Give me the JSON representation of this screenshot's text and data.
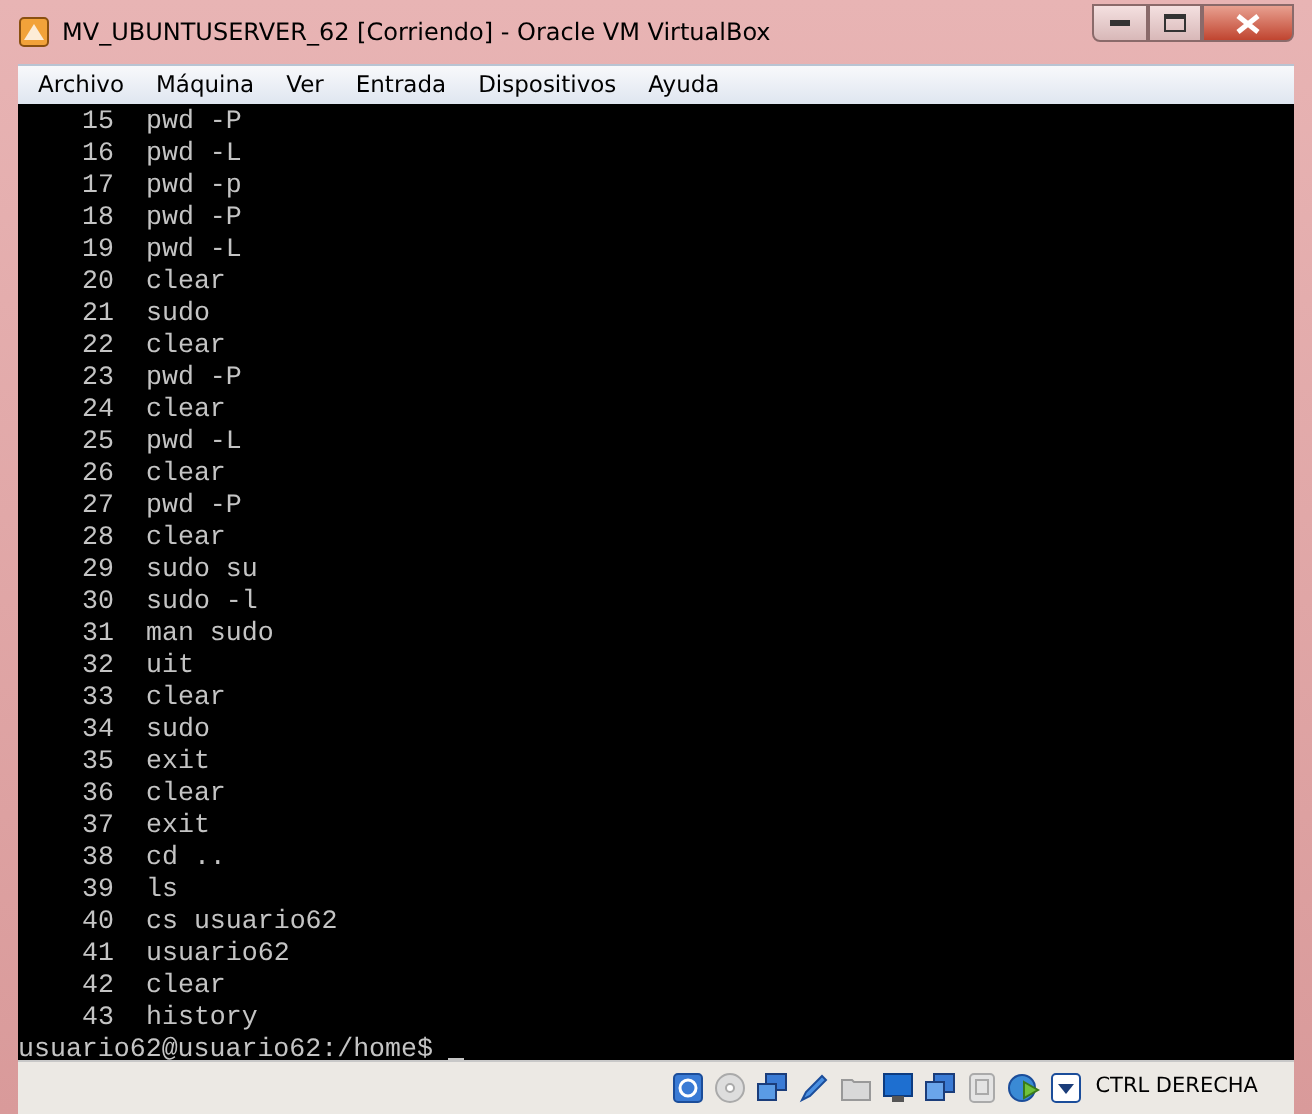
{
  "window": {
    "title": "MV_UBUNTUSERVER_62 [Corriendo] - Oracle VM VirtualBox"
  },
  "menu": [
    "Archivo",
    "Máquina",
    "Ver",
    "Entrada",
    "Dispositivos",
    "Ayuda"
  ],
  "terminal": {
    "history": [
      {
        "number": "15",
        "command": "pwd -P"
      },
      {
        "number": "16",
        "command": "pwd -L"
      },
      {
        "number": "17",
        "command": "pwd -p"
      },
      {
        "number": "18",
        "command": "pwd -P"
      },
      {
        "number": "19",
        "command": "pwd -L"
      },
      {
        "number": "20",
        "command": "clear"
      },
      {
        "number": "21",
        "command": "sudo"
      },
      {
        "number": "22",
        "command": "clear"
      },
      {
        "number": "23",
        "command": "pwd -P"
      },
      {
        "number": "24",
        "command": "clear"
      },
      {
        "number": "25",
        "command": "pwd -L"
      },
      {
        "number": "26",
        "command": "clear"
      },
      {
        "number": "27",
        "command": "pwd -P"
      },
      {
        "number": "28",
        "command": "clear"
      },
      {
        "number": "29",
        "command": "sudo su"
      },
      {
        "number": "30",
        "command": "sudo -l"
      },
      {
        "number": "31",
        "command": "man sudo"
      },
      {
        "number": "32",
        "command": "uit"
      },
      {
        "number": "33",
        "command": "clear"
      },
      {
        "number": "34",
        "command": "sudo"
      },
      {
        "number": "35",
        "command": "exit"
      },
      {
        "number": "36",
        "command": "clear"
      },
      {
        "number": "37",
        "command": "exit"
      },
      {
        "number": "38",
        "command": "cd .."
      },
      {
        "number": "39",
        "command": "ls"
      },
      {
        "number": "40",
        "command": "cs usuario62"
      },
      {
        "number": "41",
        "command": "usuario62"
      },
      {
        "number": "42",
        "command": "clear"
      },
      {
        "number": "43",
        "command": "history"
      }
    ],
    "prompt": "usuario62@usuario62:/home$"
  },
  "status_bar": {
    "host_key": "CTRL DERECHA"
  }
}
